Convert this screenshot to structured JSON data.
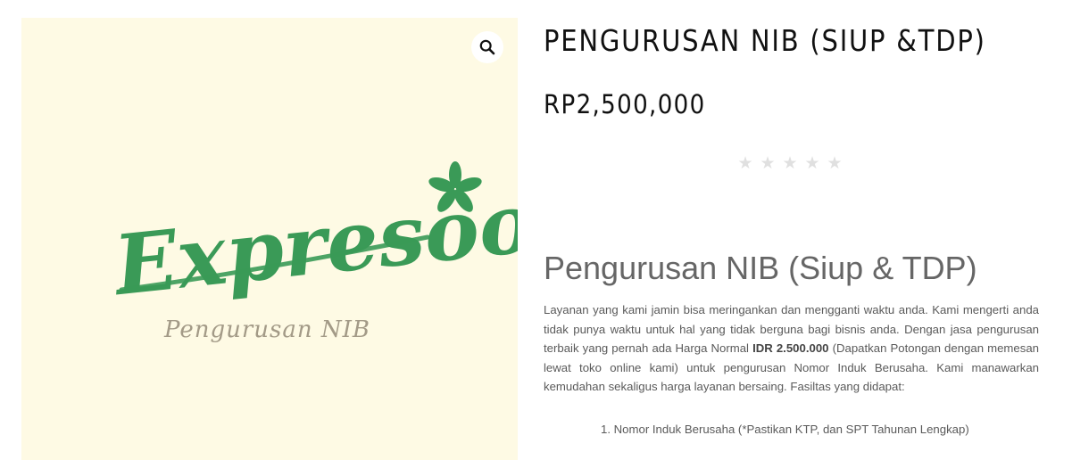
{
  "product": {
    "title": "PENGURUSAN NIB (SIUP &TDP)",
    "price": "RP2,500,000",
    "rating": {
      "stars_total": 5,
      "stars_filled": 0
    }
  },
  "image": {
    "brand_name": "Expresoo",
    "brand_subtitle": "Pengurusan NIB",
    "zoom_icon": "magnifier-icon",
    "colors": {
      "background": "#fefae4",
      "brand_green": "#3a9a57",
      "subtitle": "#a39a87"
    }
  },
  "description": {
    "heading": "Pengurusan NIB (Siup & TDP)",
    "paragraph_before": "Layanan yang kami jamin bisa meringankan dan mengganti waktu anda. Kami mengerti anda tidak punya waktu untuk hal yang tidak berguna bagi bisnis anda. Dengan jasa pengurusan terbaik yang pernah ada Harga Normal ",
    "paragraph_bold": "IDR 2.500.000",
    "paragraph_after": " (Dapatkan Potongan dengan memesan lewat toko online kami) untuk pengurusan Nomor Induk Berusaha. Kami manawarkan kemudahan sekaligus harga layanan bersaing. Fasiltas yang didapat:",
    "features": [
      "1. Nomor Induk Berusaha (*Pastikan KTP, dan SPT Tahunan Lengkap)"
    ]
  }
}
